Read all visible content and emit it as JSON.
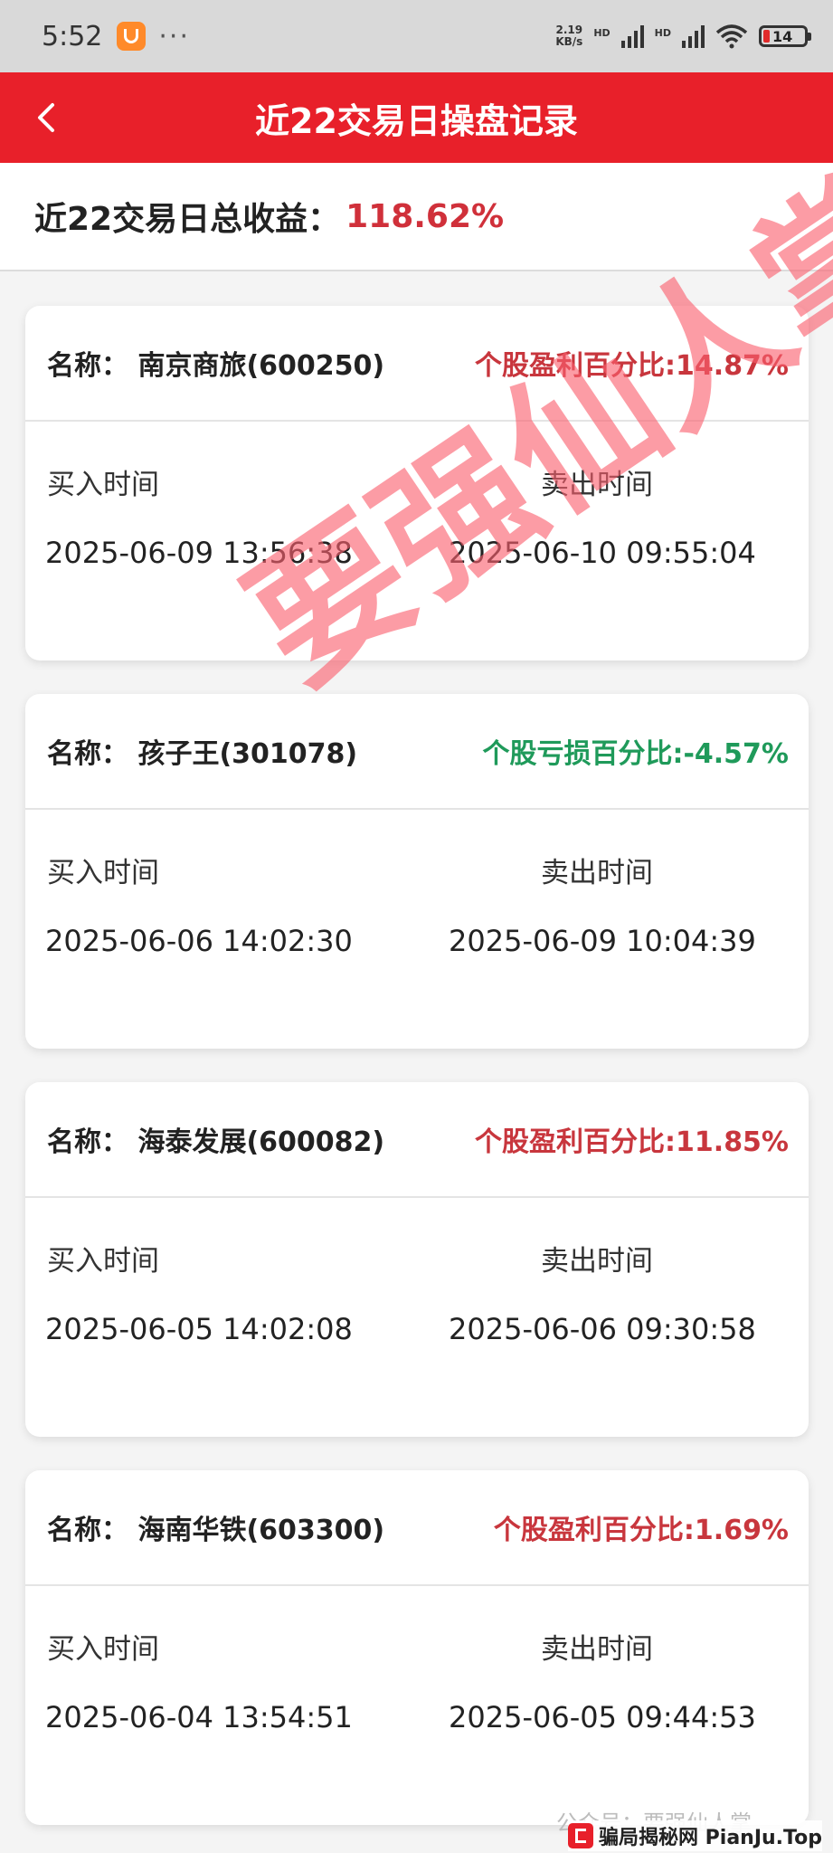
{
  "statusbar": {
    "time": "5:52",
    "dots": "···",
    "net_rate": "2.19",
    "net_unit": "KB/s",
    "hd1": "HD",
    "hd2": "HD",
    "battery": "14"
  },
  "header": {
    "title": "近22交易日操盘记录"
  },
  "summary": {
    "label": "近22交易日总收益：",
    "value": "118.62%"
  },
  "labels": {
    "buy": "买入时间",
    "sell": "卖出时间"
  },
  "records": [
    {
      "name": "名称：  南京商旅(600250)",
      "pct": "个股盈利百分比:14.87%",
      "buy_time": "2025-06-09 13:56:38",
      "sell_time": "2025-06-10 09:55:04"
    },
    {
      "name": "名称：  孩子王(301078)",
      "pct": "个股亏损百分比:-4.57%",
      "buy_time": "2025-06-06 14:02:30",
      "sell_time": "2025-06-09 10:04:39"
    },
    {
      "name": "名称：  海泰发展(600082)",
      "pct": "个股盈利百分比:11.85%",
      "buy_time": "2025-06-05 14:02:08",
      "sell_time": "2025-06-06 09:30:58"
    },
    {
      "name": "名称：  海南华铁(603300)",
      "pct": "个股盈利百分比:1.69%",
      "buy_time": "2025-06-04 13:54:51",
      "sell_time": "2025-06-05 09:44:53"
    }
  ],
  "watermark": "要强仙人掌",
  "footer": {
    "wechat": "公众号：要强仙人掌",
    "brand": "骗局揭秘网  PianJu.Top"
  },
  "colors": {
    "header_red": "#e8202a",
    "profit": "#c8363d",
    "loss": "#1f9a5a"
  }
}
